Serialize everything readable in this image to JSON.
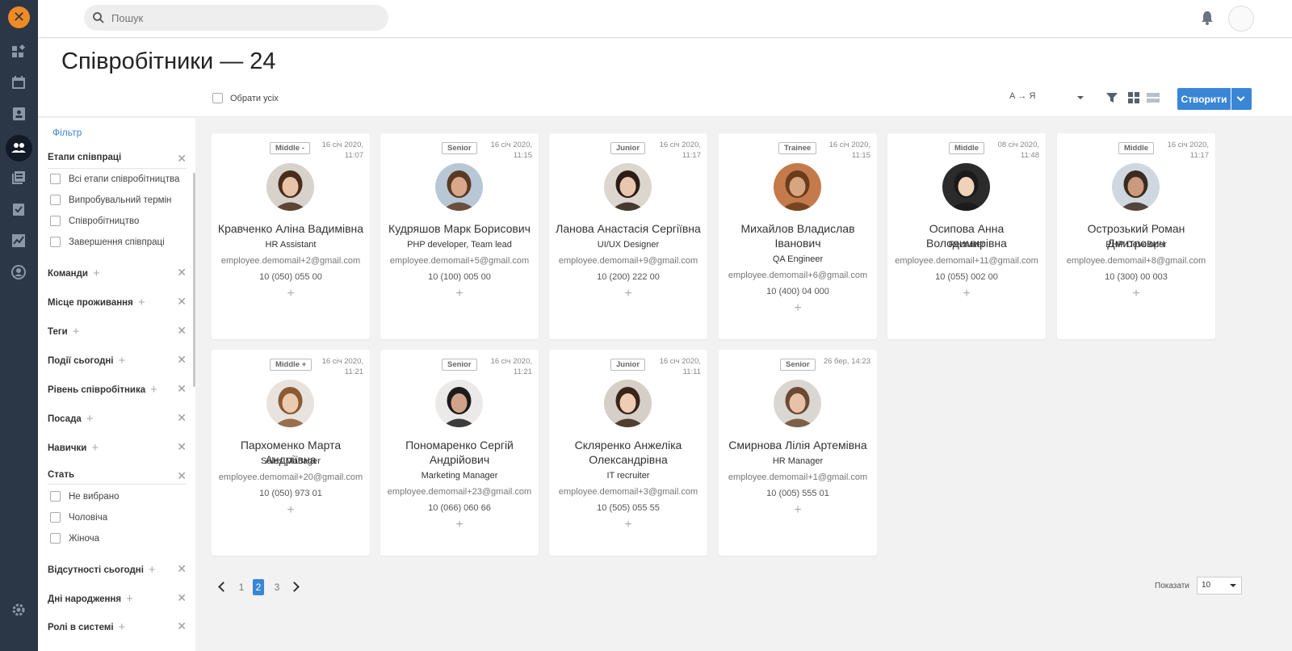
{
  "app": {
    "logo_glyph": "✕",
    "accent_color": "#3a86d6",
    "brand_color": "#f08a24"
  },
  "nav": {
    "icons": [
      "dashboard-icon",
      "calendar-icon",
      "contacts-icon",
      "employees-icon",
      "library-icon",
      "tasks-icon",
      "analytics-icon",
      "profile-icon",
      "settings-icon"
    ]
  },
  "search": {
    "placeholder": "Пошук",
    "value": ""
  },
  "header": {
    "title": "Співробітники — 24",
    "select_all": "Обрати усіх",
    "sort": "А → Я",
    "create": "Створити"
  },
  "sidebar": {
    "title": "Фільтр",
    "stages": {
      "title": "Етапи співпраці",
      "options": [
        "Всі етапи співробітництва",
        "Випробувальний термін",
        "Співробітництво",
        "Завершення співпраці"
      ]
    },
    "sections": [
      "Команди",
      "Місце проживання",
      "Теги",
      "Події сьогодні",
      "Рівень співробітника",
      "Посада",
      "Навички"
    ],
    "gender": {
      "title": "Стать",
      "options": [
        "Не вибрано",
        "Чоловіча",
        "Жіноча"
      ]
    },
    "sections2": [
      "Відсутності сьогодні",
      "Дні народження",
      "Ролі в системі"
    ]
  },
  "cards": [
    {
      "level": "Middle -",
      "date1": "16 січ 2020,",
      "date2": "11:07",
      "name": "Кравченко Аліна Вадимівна",
      "position": "HR Assistant",
      "email": "employee.demomail+2@gmail.com",
      "phone": "10 (050) 055 00"
    },
    {
      "level": "Senior",
      "date1": "16 січ 2020,",
      "date2": "11:15",
      "name": "Кудряшов Марк Борисович",
      "position": "PHP developer, Team lead",
      "email": "employee.demomail+5@gmail.com",
      "phone": "10 (100) 005 00"
    },
    {
      "level": "Junior",
      "date1": "16 січ 2020,",
      "date2": "11:17",
      "name": "Ланова Анастасія Сергіївна",
      "position": "UI/UX Designer",
      "email": "employee.demomail+9@gmail.com",
      "phone": "10 (200) 222 00"
    },
    {
      "level": "Trainee",
      "date1": "16 січ 2020,",
      "date2": "11:15",
      "name": "Михайлов Владислав Іванович",
      "position": "QA Engineer",
      "email": "employee.demomail+6@gmail.com",
      "phone": "10 (400) 04 000"
    },
    {
      "level": "Middle",
      "date1": "08 січ 2020,",
      "date2": "11:48",
      "name": "Осипова Анна Володимирівна",
      "position": "Recruiter",
      "email": "employee.demomail+11@gmail.com",
      "phone": "10 (055) 002 00"
    },
    {
      "level": "Middle",
      "date1": "16 січ 2020,",
      "date2": "11:17",
      "name": "Острозький Роман Дмитрович",
      "position": "PHP Developer",
      "email": "employee.demomail+8@gmail.com",
      "phone": "10 (300) 00 003"
    },
    {
      "level": "Middle +",
      "date1": "16 січ 2020,",
      "date2": "11:21",
      "name": "Пархоменко Марта Андріївна",
      "position": "Sales Manager",
      "email": "employee.demomail+20@gmail.com",
      "phone": "10 (050) 973 01"
    },
    {
      "level": "Senior",
      "date1": "16 січ 2020,",
      "date2": "11:21",
      "name": "Пономаренко Сергій Андрійович",
      "position": "Marketing Manager",
      "email": "employee.demomail+23@gmail.com",
      "phone": "10 (066) 060 66"
    },
    {
      "level": "Junior",
      "date1": "16 січ 2020,",
      "date2": "11:11",
      "name": "Скляренко Анжеліка Олександрівна",
      "position": "IT recruiter",
      "email": "employee.demomail+3@gmail.com",
      "phone": "10 (505) 055 55"
    },
    {
      "level": "Senior",
      "date1": "26 бер, 14:23",
      "date2": "",
      "name": "Смирнова Лілія Артемівна",
      "position": "HR Manager",
      "email": "employee.demomail+1@gmail.com",
      "phone": "10 (005) 555 01"
    }
  ],
  "pagination": {
    "pages": [
      "1",
      "2",
      "3"
    ],
    "current": "2",
    "show_label": "Показати",
    "per_page": "10"
  }
}
